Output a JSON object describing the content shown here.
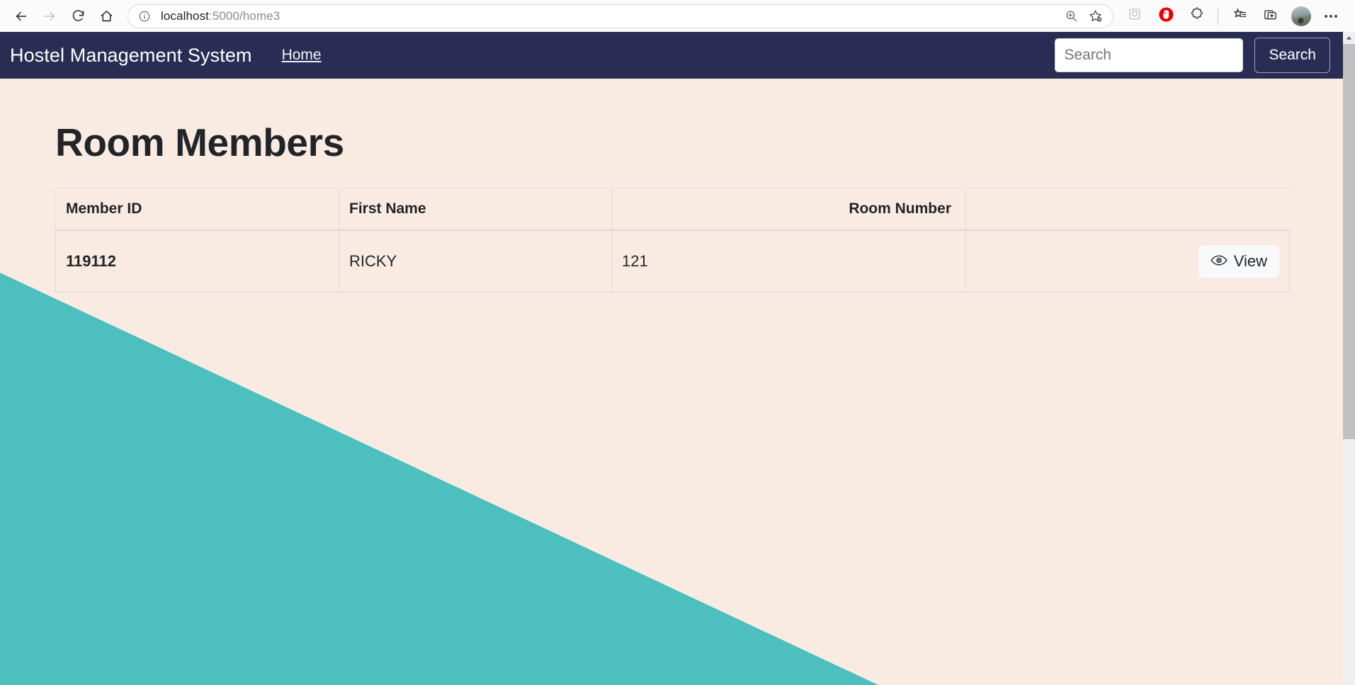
{
  "browser": {
    "back_label": "Back",
    "forward_label": "Forward",
    "refresh_label": "Refresh",
    "home_label": "Home",
    "url_prefix": "localhost",
    "url_suffix": ":5000/home3",
    "url_full": "localhost:5000/home3",
    "icons": {
      "back": "back-arrow-icon",
      "forward": "forward-arrow-icon",
      "refresh": "refresh-icon",
      "home": "home-icon",
      "site_info": "info-circle-icon",
      "zoom": "zoom-in-icon",
      "add_favorite": "add-favorite-star-icon",
      "split_screen": "split-screen-icon",
      "adblock": "adblock-stop-hand-icon",
      "extensions": "extensions-puzzle-icon",
      "favorites": "favorites-star-list-icon",
      "collections": "collections-add-icon",
      "profile": "profile-avatar",
      "settings": "settings-more-icon"
    }
  },
  "navbar": {
    "brand": "Hostel Management System",
    "links": [
      {
        "label": "Home"
      }
    ],
    "search": {
      "placeholder": "Search",
      "value": "",
      "button_label": "Search"
    }
  },
  "page": {
    "title": "Room Members"
  },
  "table": {
    "columns": [
      {
        "label": "Member ID",
        "align": "left"
      },
      {
        "label": "First Name",
        "align": "left"
      },
      {
        "label": "Room Number",
        "align": "right"
      },
      {
        "label": "",
        "align": "left"
      }
    ],
    "rows": [
      {
        "member_id": "119112",
        "first_name": "RICKY",
        "room_number": "121",
        "action_label": "View",
        "action_icon": "eye-icon"
      }
    ]
  },
  "colors": {
    "navbar_bg": "#2a2c54",
    "page_bg": "#faebe2",
    "accent_teal": "#4cbfbe",
    "text_dark": "#212529",
    "table_border": "#d5d9e0",
    "button_bg": "#f8f9fa"
  }
}
